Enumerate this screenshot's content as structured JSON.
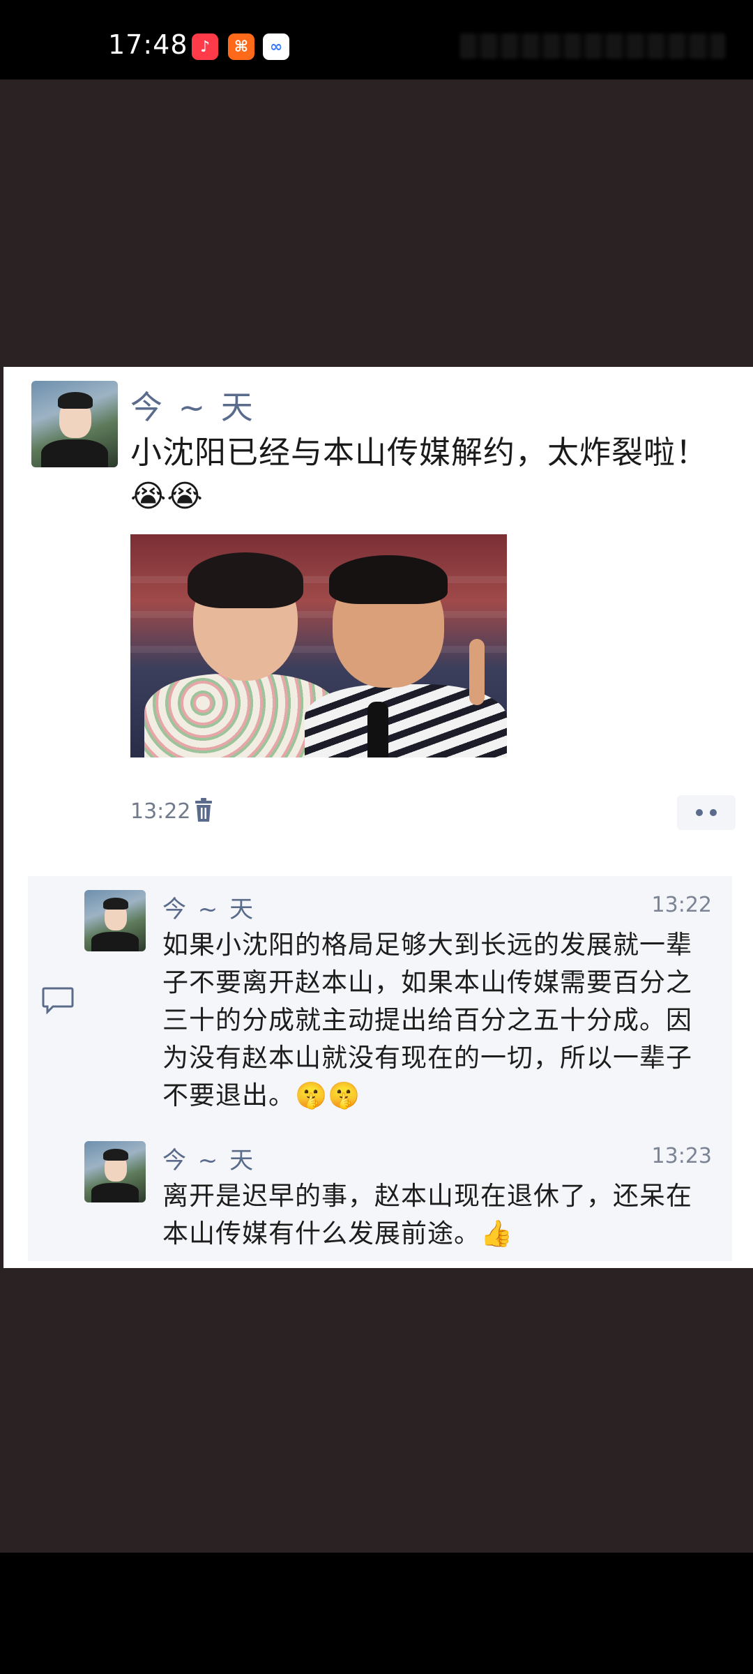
{
  "status_bar": {
    "time": "17:48",
    "app_icons": [
      {
        "name": "music-app-icon",
        "color": "#ff3b4a",
        "glyph": "♪"
      },
      {
        "name": "shopping-app-icon",
        "color": "#ff6a1a",
        "glyph": "⌘"
      },
      {
        "name": "cloud-app-icon",
        "color": "#ffffff",
        "glyph": "∞"
      }
    ]
  },
  "post": {
    "author": "今 ~ 天",
    "text": "小沈阳已经与本山传媒解约，太炸裂啦！",
    "emojis": "😭😭",
    "time": "13:22",
    "image_alt": "photo"
  },
  "replies": [
    {
      "author": "今 ~ 天",
      "time": "13:22",
      "text": "如果小沈阳的格局足够大到长远的发展就一辈子不要离开赵本山，如果本山传媒需要百分之三十的分成就主动提出给百分之五十分成。因为没有赵本山就没有现在的一切，所以一辈子不要退出。🤫🤫"
    },
    {
      "author": "今 ~ 天",
      "time": "13:23",
      "text": "离开是迟早的事，赵本山现在退休了，还呆在本山传媒有什么发展前途。👍"
    }
  ],
  "colors": {
    "name_blue": "#5a6b8c",
    "background_dark": "#2a2223"
  }
}
